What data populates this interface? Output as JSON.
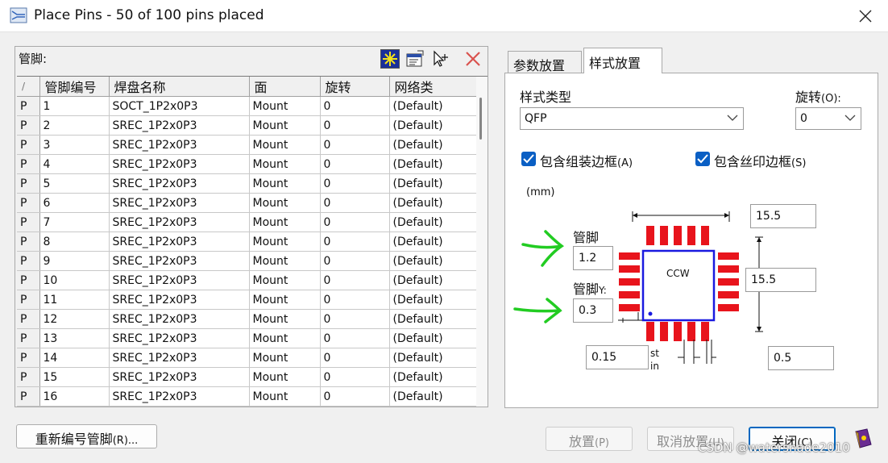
{
  "window": {
    "title": "Place Pins - 50 of 100 pins placed"
  },
  "pins_panel": {
    "label": "管脚:",
    "columns": [
      "/",
      "管脚编号",
      "焊盘名称",
      "面",
      "旋转",
      "网络类"
    ],
    "rows": [
      [
        "P",
        "1",
        "SOCT_1P2x0P3",
        "Mount",
        "0",
        "(Default)"
      ],
      [
        "P",
        "2",
        "SREC_1P2x0P3",
        "Mount",
        "0",
        "(Default)"
      ],
      [
        "P",
        "3",
        "SREC_1P2x0P3",
        "Mount",
        "0",
        "(Default)"
      ],
      [
        "P",
        "4",
        "SREC_1P2x0P3",
        "Mount",
        "0",
        "(Default)"
      ],
      [
        "P",
        "5",
        "SREC_1P2x0P3",
        "Mount",
        "0",
        "(Default)"
      ],
      [
        "P",
        "6",
        "SREC_1P2x0P3",
        "Mount",
        "0",
        "(Default)"
      ],
      [
        "P",
        "7",
        "SREC_1P2x0P3",
        "Mount",
        "0",
        "(Default)"
      ],
      [
        "P",
        "8",
        "SREC_1P2x0P3",
        "Mount",
        "0",
        "(Default)"
      ],
      [
        "P",
        "9",
        "SREC_1P2x0P3",
        "Mount",
        "0",
        "(Default)"
      ],
      [
        "P",
        "10",
        "SREC_1P2x0P3",
        "Mount",
        "0",
        "(Default)"
      ],
      [
        "P",
        "11",
        "SREC_1P2x0P3",
        "Mount",
        "0",
        "(Default)"
      ],
      [
        "P",
        "12",
        "SREC_1P2x0P3",
        "Mount",
        "0",
        "(Default)"
      ],
      [
        "P",
        "13",
        "SREC_1P2x0P3",
        "Mount",
        "0",
        "(Default)"
      ],
      [
        "P",
        "14",
        "SREC_1P2x0P3",
        "Mount",
        "0",
        "(Default)"
      ],
      [
        "P",
        "15",
        "SREC_1P2x0P3",
        "Mount",
        "0",
        "(Default)"
      ],
      [
        "P",
        "16",
        "SREC_1P2x0P3",
        "Mount",
        "0",
        "(Default)"
      ]
    ],
    "tools": [
      "auto-place-icon",
      "properties-icon",
      "select-pins-icon",
      "delete-icon"
    ]
  },
  "tabs": [
    {
      "label": "参数放置",
      "active": false
    },
    {
      "label": "样式放置",
      "active": true
    }
  ],
  "style_tab": {
    "style_type_label": "样式类型",
    "style_type_value": "QFP",
    "rotation_label": "旋转",
    "rotation_hotkey": "(O):",
    "rotation_value": "0",
    "include_assembly_label": "包含组装边框",
    "include_assembly_hotkey": "(A)",
    "include_assembly_checked": true,
    "include_silk_label": "包含丝印边框",
    "include_silk_hotkey": "(S)",
    "include_silk_checked": true,
    "units_label": "(mm)",
    "pin_label_1": "管脚",
    "pin_value_1": "1.2",
    "pin_label_2": "管脚",
    "pin_label_2_suffix": "Y:",
    "pin_value_2": "0.3",
    "width_value": "15.5",
    "height_value": "15.5",
    "bottom_left_value": "0.15",
    "bottom_right_value": "0.5",
    "ccw_label": "CCW",
    "st_label": "st",
    "in_label": "in"
  },
  "buttons": {
    "renumber": "重新编号管脚",
    "renumber_hotkey": "(R)...",
    "place": "放置",
    "place_hotkey": "(P)",
    "unplace": "取消放置",
    "unplace_hotkey": "(U)",
    "close": "关闭",
    "close_hotkey": "(C)"
  },
  "watermark": "CSDN @watershade2010",
  "colors": {
    "pad_red": "#e8141c",
    "body_blue": "#1a1ae0",
    "arrow_green": "#22cc22",
    "checkbox_blue": "#0a5fc4"
  }
}
